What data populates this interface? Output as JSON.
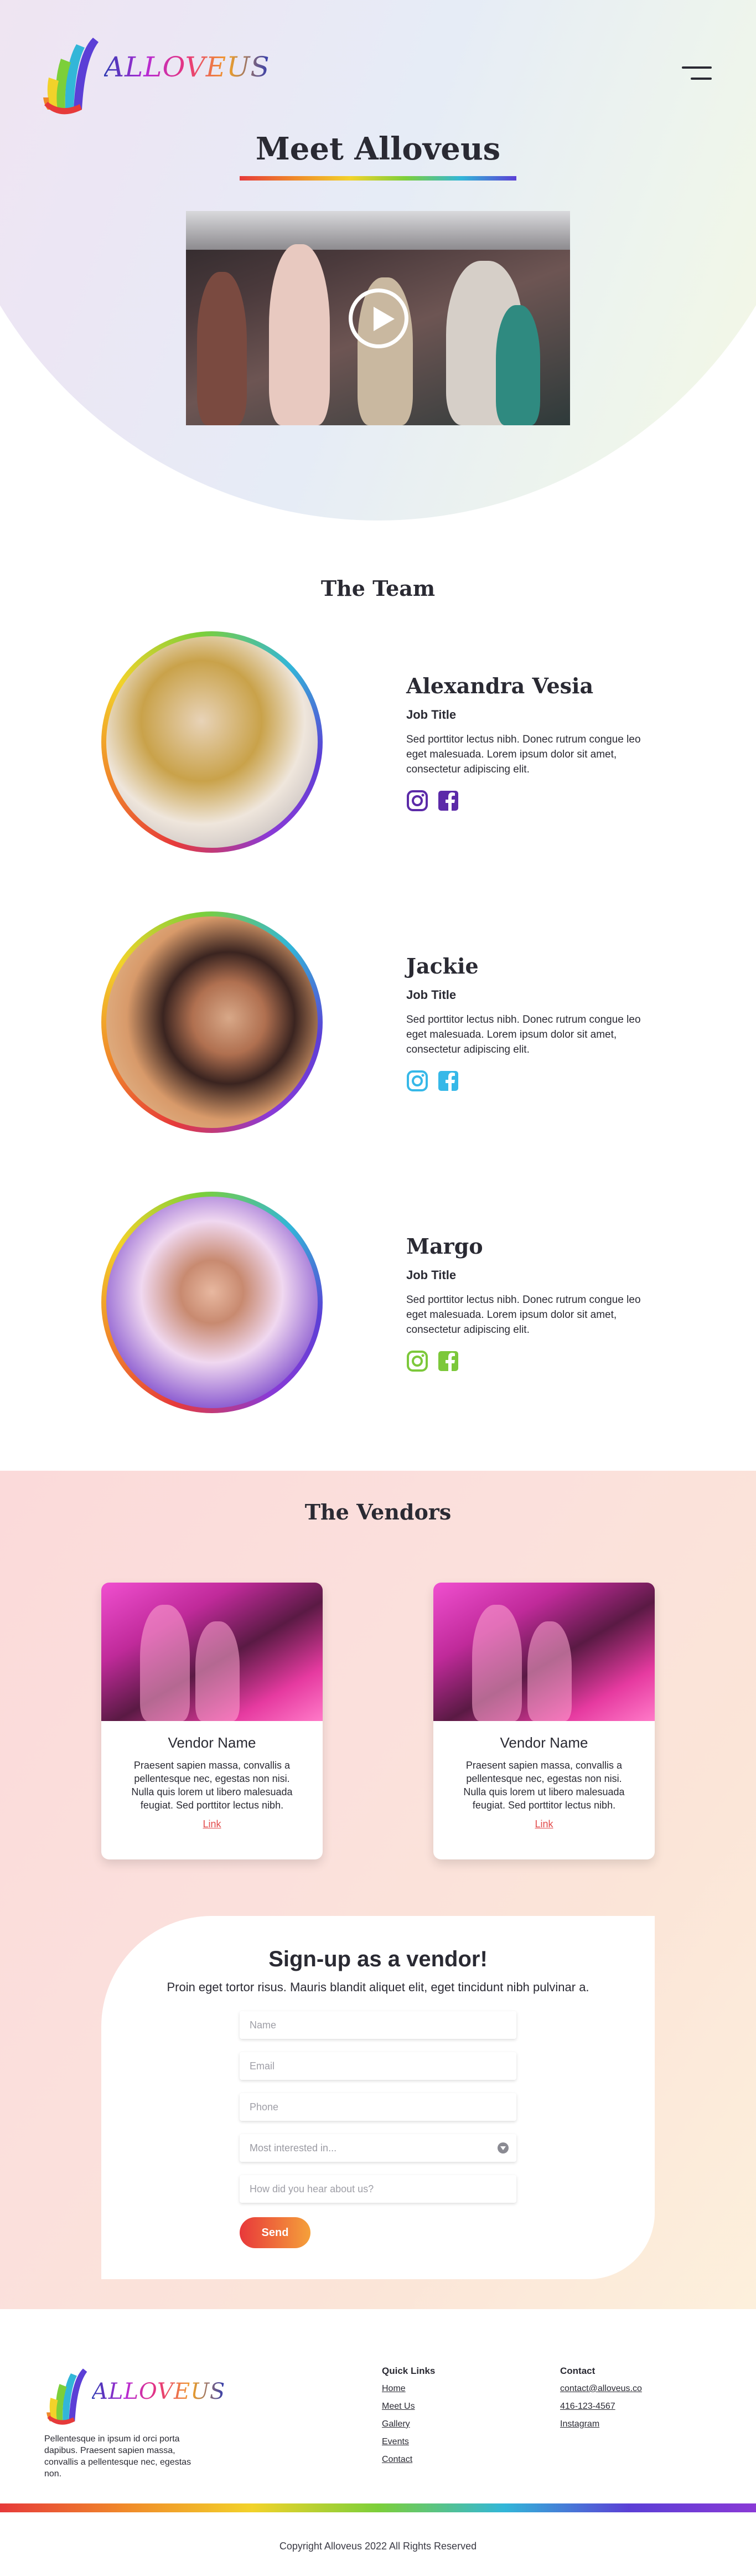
{
  "header": {
    "logo_text": "ALLOVEUS",
    "menu_icon": "hamburger-menu-icon"
  },
  "hero": {
    "title": "Meet Alloveus",
    "video_icon": "play-icon"
  },
  "team": {
    "title": "The Team",
    "members": [
      {
        "name": "Alexandra Vesia",
        "role": "Job Title",
        "bio": "Sed porttitor lectus nibh. Donec rutrum congue leo eget malesuada. Lorem ipsum dolor sit amet, consectetur adipiscing elit.",
        "icon_color": "#5b2aa8"
      },
      {
        "name": "Jackie",
        "role": "Job Title",
        "bio": "Sed porttitor lectus nibh. Donec rutrum congue leo eget malesuada. Lorem ipsum dolor sit amet, consectetur adipiscing elit.",
        "icon_color": "#36b8e8"
      },
      {
        "name": "Margo",
        "role": "Job Title",
        "bio": "Sed porttitor lectus nibh. Donec rutrum congue leo eget malesuada. Lorem ipsum dolor sit amet, consectetur adipiscing elit.",
        "icon_color": "#7cc83a"
      }
    ]
  },
  "vendors": {
    "title": "The Vendors",
    "cards": [
      {
        "name": "Vendor Name",
        "desc": "Praesent sapien massa, convallis a pellentesque nec, egestas non nisi. Nulla quis lorem ut libero malesuada feugiat. Sed porttitor lectus nibh.",
        "link": "Link"
      },
      {
        "name": "Vendor Name",
        "desc": "Praesent sapien massa, convallis a pellentesque nec, egestas non nisi. Nulla quis lorem ut libero malesuada feugiat. Sed porttitor lectus nibh.",
        "link": "Link"
      }
    ]
  },
  "signup": {
    "title": "Sign-up as a vendor!",
    "subtitle": "Proin eget tortor risus. Mauris blandit aliquet elit, eget tincidunt nibh pulvinar a.",
    "name_placeholder": "Name",
    "email_placeholder": "Email",
    "phone_placeholder": "Phone",
    "interest_value": "Most interested in...",
    "hear_placeholder": "How did you hear about us?",
    "send_label": "Send"
  },
  "footer": {
    "logo_text": "ALLOVEUS",
    "description": "Pellentesque in ipsum id orci porta dapibus. Praesent sapien massa, convallis a pellentesque nec, egestas non.",
    "quick_links_title": "Quick Links",
    "quick_links": [
      "Home",
      "Meet Us",
      "Gallery",
      "Events",
      "Contact"
    ],
    "contact_title": "Contact",
    "contact_email": "contact@alloveus.co",
    "contact_phone": "416-123-4567",
    "contact_instagram": "Instagram",
    "copyright": "Copyright Alloveus 2022 All Rights Reserved"
  }
}
